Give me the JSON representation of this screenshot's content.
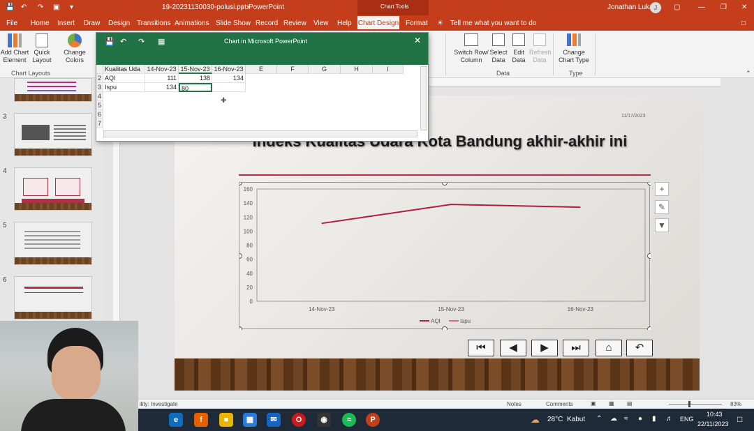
{
  "titlebar": {
    "filename": "19-20231130030-polusi.pptx",
    "app": "PowerPoint",
    "context_tab_group": "Chart Tools",
    "user": "Jonathan Lukas",
    "user_initial": "J",
    "autosave_icon": "save-icon"
  },
  "tabs": [
    "File",
    "Home",
    "Insert",
    "Draw",
    "Design",
    "Transitions",
    "Animations",
    "Slide Show",
    "Record",
    "Review",
    "View",
    "Help"
  ],
  "active_tab": "Chart Design",
  "format_tab": "Format",
  "tell_me": "Tell me what you want to do",
  "ribbon": {
    "add_chart_element": "Add Chart Element",
    "quick_layout": "Quick Layout",
    "change_colors": "Change Colors",
    "chart_layouts_group": "Chart Layouts",
    "switch_row_column": "Switch Row/ Column",
    "select_data": "Select Data",
    "edit_data": "Edit Data",
    "refresh_data": "Refresh Data",
    "data_group": "Data",
    "change_chart_type": "Change Chart Type",
    "type_group": "Type"
  },
  "slide_numbers": [
    "3",
    "4",
    "5",
    "6"
  ],
  "data_window": {
    "title": "Chart in Microsoft PowerPoint",
    "columns": [
      "Kualitas Uda",
      "14-Nov-23",
      "15-Nov-23",
      "16-Nov-23",
      "E",
      "F",
      "G",
      "H",
      "I"
    ],
    "row_numbers": [
      "2",
      "3",
      "4",
      "5",
      "6",
      "7"
    ],
    "rows": [
      {
        "label": "AQI",
        "values": [
          "111",
          "138",
          "134"
        ]
      },
      {
        "label": "Ispu",
        "values": [
          "134",
          "80",
          ""
        ]
      }
    ]
  },
  "slide": {
    "date": "11/17/2023",
    "title": "Indeks Kualitas Udara Kota Bandung akhir-akhir ini",
    "nav_buttons": [
      "first-slide-icon",
      "prev-icon",
      "next-icon",
      "last-slide-icon",
      "home-icon",
      "return-icon"
    ]
  },
  "chart_data": {
    "type": "line",
    "categories": [
      "14-Nov-23",
      "15-Nov-23",
      "16-Nov-23"
    ],
    "series": [
      {
        "name": "AQI",
        "values": [
          111,
          138,
          134
        ],
        "color": "#b01e3c"
      },
      {
        "name": "Ispu",
        "values": [],
        "color": "#e0609a"
      }
    ],
    "yticks": [
      "0",
      "20",
      "40",
      "60",
      "80",
      "100",
      "120",
      "140",
      "160"
    ],
    "ylim": [
      0,
      160
    ],
    "legend": "bottom",
    "grid": false
  },
  "statusbar": {
    "accessibility": "ility: Investigate",
    "notes": "Notes",
    "comments": "Comments",
    "zoom": "83%"
  },
  "taskbar": {
    "weather": "28°C",
    "weather_desc": "Kabut",
    "lang": "ENG",
    "time": "10:43",
    "date": "22/11/2023"
  }
}
